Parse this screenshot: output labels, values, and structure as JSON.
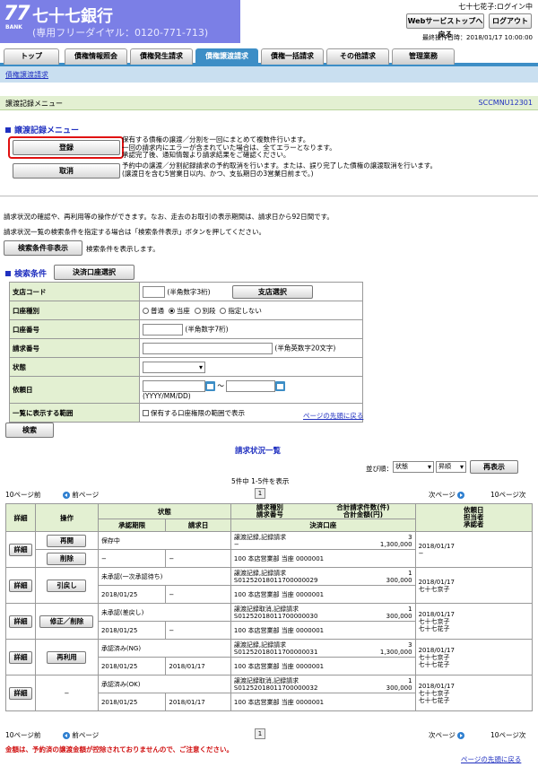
{
  "header": {
    "bank_name": "七十七銀行",
    "logo_77": "77",
    "logo_bank": "BANK",
    "freedial": "(専用フリーダイヤル：0120-771-713)",
    "user_status": "七十七花子:ログイン中",
    "top_button": "Webサービストップへ戻る",
    "logout_button": "ログアウト",
    "last_operation": "最終操作日時：2018/01/17 10:00:00"
  },
  "tabs": [
    "トップ",
    "債権情報照会",
    "債権発生請求",
    "債権譲渡請求",
    "債権一括請求",
    "その他請求",
    "管理業務"
  ],
  "subnav": "債権譲渡請求",
  "page": {
    "title": "譲渡記録メニュー",
    "screen_id": "SCCMNU12301"
  },
  "menu": {
    "section_title": "譲渡記録メニュー",
    "register_label": "登録",
    "register_desc": [
      "保有する債権の譲渡／分割を一回にまとめて複数件行います。",
      "一回の請求内にエラーが含まれていた場合は、全てエラーとなります。",
      "承認完了後、通知情報より請求結果をご確認ください。"
    ],
    "cancel_label": "取消",
    "cancel_desc": [
      "予約中の譲渡／分割記録請求の予約取消を行います。または、誤り完了した債権の譲渡取消を行います。",
      "(譲渡日を含む5営業日以内、かつ、支払期日の3営業日前まで。)"
    ]
  },
  "info": {
    "line1": "請求状況の確認や、再利用等の操作ができます。なお、走去のお取引の表示期間は、請求日から92日間です。",
    "line2": "請求状況一覧の検索条件を指定する場合は「検索条件表示」ボタンを押してください。",
    "toggle_label": "検索条件非表示",
    "toggle_desc": "検索条件を表示します。"
  },
  "search": {
    "section_title": "検索条件",
    "account_button": "決済口座選択",
    "branch_label": "支店コード",
    "branch_hint": "(半角数字3桁)",
    "branch_button": "支店選択",
    "acct_type_label": "口座種別",
    "acct_types": [
      "普通",
      "当座",
      "別段",
      "指定しない"
    ],
    "acct_no_label": "口座番号",
    "acct_no_hint": "(半角数字7桁)",
    "req_no_label": "請求番号",
    "req_no_hint": "(半角英数字20文字)",
    "status_label": "状態",
    "date_label": "依頼日",
    "date_sep": "〜",
    "date_hint": "(YYYY/MM/DD)",
    "range_label": "一覧に表示する範囲",
    "range_option": "保有する口座権限の範囲で表示",
    "to_top": "ページの先頭に戻る",
    "search_button": "検索"
  },
  "list": {
    "title": "請求状況一覧",
    "sort_label": "並び順：",
    "sort_field": "状態",
    "sort_order": "昇順",
    "resort_button": "再表示",
    "count_text": "5件中 1-5件を表示",
    "prev10": "10ページ前",
    "prev": "前ページ",
    "page": "1",
    "next": "次ページ",
    "next10": "10ページ次",
    "headers": {
      "detail": "詳細",
      "action": "操作",
      "status": "状態",
      "approval": "承認期限",
      "request_date": "請求日",
      "type_no": "請求種別\n請求番号",
      "count_amount": "合計請求件数(件)\n合計金額(円)",
      "account": "決済口座",
      "requester": "依頼日\n担当者\n承認者"
    },
    "rows": [
      {
        "detail": "詳細",
        "actions": [
          "再開",
          "削除"
        ],
        "status": "保存中",
        "approval": "−",
        "req_date": "−",
        "type": "譲渡記録,記録請求",
        "no": "−",
        "count": "3",
        "amount": "1,300,000",
        "account": "100 本店営業部 当座 0000001",
        "date": "2018/01/17",
        "p1": "−",
        "p2": ""
      },
      {
        "detail": "詳細",
        "actions": [
          "引戻し"
        ],
        "status": "未承認(一次承認待ち)",
        "approval": "2018/01/25",
        "req_date": "−",
        "type": "譲渡記録,記録請求",
        "no": "S01252018011700000029",
        "count": "1",
        "amount": "300,000",
        "account": "100 本店営業部 当座 0000001",
        "date": "2018/01/17",
        "p1": "七十七京子",
        "p2": ""
      },
      {
        "detail": "詳細",
        "actions": [
          "修正／削除"
        ],
        "status": "未承認(差戻し)",
        "approval": "2018/01/25",
        "req_date": "−",
        "type": "譲渡記録取消,記録請求",
        "no": "S01252018011700000030",
        "count": "1",
        "amount": "300,000",
        "account": "100 本店営業部 当座 0000001",
        "date": "2018/01/17",
        "p1": "七十七京子",
        "p2": "七十七花子"
      },
      {
        "detail": "詳細",
        "actions": [
          "再利用"
        ],
        "status": "承認済み(NG)",
        "approval": "2018/01/25",
        "req_date": "2018/01/17",
        "type": "譲渡記録,記録請求",
        "no": "S01252018011700000031",
        "count": "3",
        "amount": "1,300,000",
        "account": "100 本店営業部 当座 0000001",
        "date": "2018/01/17",
        "p1": "七十七京子",
        "p2": "七十七花子"
      },
      {
        "detail": "詳細",
        "actions": [
          "−"
        ],
        "status": "承認済み(OK)",
        "approval": "2018/01/25",
        "req_date": "2018/01/17",
        "type": "譲渡記録取消,記録請求",
        "no": "S01252018011700000032",
        "count": "1",
        "amount": "300,000",
        "account": "100 本店営業部 当座 0000001",
        "date": "2018/01/17",
        "p1": "七十七京子",
        "p2": "七十七花子"
      }
    ],
    "to_top": "ページの先頭に戻る",
    "warning": "金額は、予約済の譲渡金額が控除されておりませんので、ご注意ください。"
  },
  "colors": {
    "brand": "#7b7fe6",
    "tab_active": "#3d8ec6",
    "label_bg": "#e3f0d2",
    "link": "#2030c0",
    "warning": "#d01010",
    "highlight": "#e01010"
  }
}
